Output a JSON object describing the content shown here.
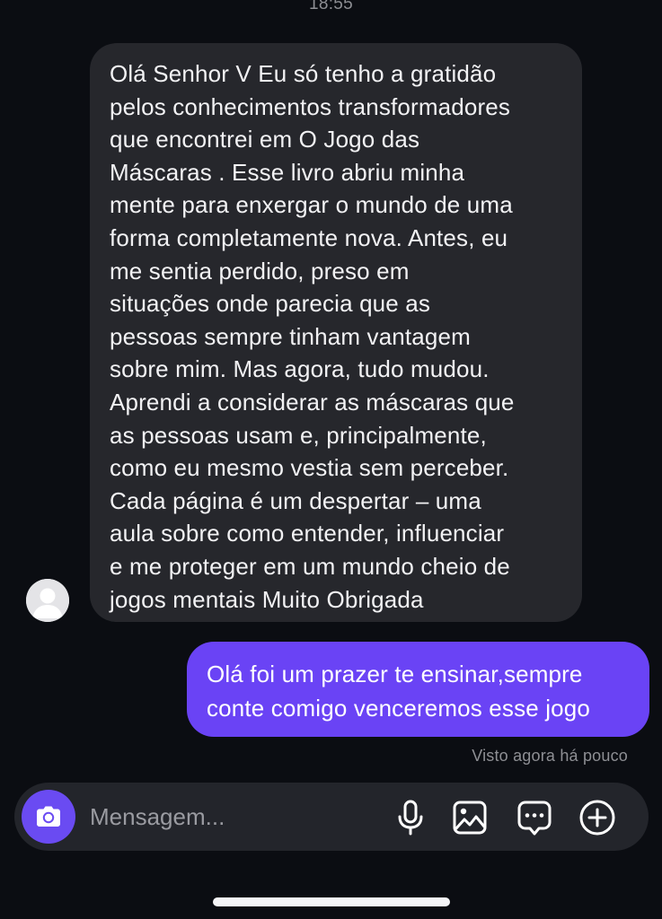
{
  "status_time": "18:55",
  "incoming_message": {
    "lines": [
      "Olá Senhor V Eu só tenho a gratidão",
      "pelos conhecimentos transformadores",
      "que encontrei em O Jogo das",
      "Máscaras . Esse livro abriu minha",
      "mente para enxergar o mundo de uma",
      "forma completamente nova. Antes, eu",
      "me sentia perdido, preso em",
      "situações onde parecia que as",
      "pessoas sempre tinham vantagem",
      "sobre mim. Mas agora, tudo mudou.",
      "Aprendi a considerar as máscaras que",
      "as pessoas usam e, principalmente,",
      "como eu mesmo vestia sem perceber.",
      "Cada página é um despertar – uma",
      "aula sobre como entender, influenciar",
      "e me proteger em um mundo cheio de",
      "jogos mentais Muito Obrigada"
    ]
  },
  "outgoing_message": {
    "lines": [
      "Olá foi um prazer te ensinar,sempre",
      "conte comigo venceremos esse jogo"
    ]
  },
  "seen_status": "Visto agora há pouco",
  "composer": {
    "placeholder": "Mensagem...",
    "icons": [
      "camera-icon",
      "microphone-icon",
      "gallery-icon",
      "sticker-icon",
      "add-icon"
    ]
  },
  "colors": {
    "background": "#0b0d12",
    "incoming_bubble": "#26272c",
    "outgoing_bubble": "#6a43f5",
    "camera_button": "#6a4bf2",
    "composer": "#23252b"
  }
}
